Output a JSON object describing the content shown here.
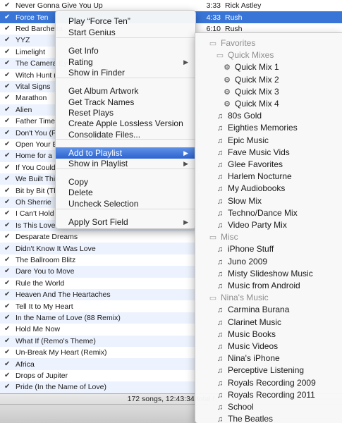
{
  "colors": {
    "selection": "#3875d7",
    "row_stripe": "#edf3fe",
    "menu_highlight": "#2c62d0"
  },
  "icons": {
    "check": "checkmark-icon",
    "submenu": "triangle-right-icon",
    "folder": "folder-icon",
    "smart_playlist": "smart-playlist-icon",
    "playlist": "playlist-icon"
  },
  "tracks": [
    {
      "name": "Never Gonna Give You Up",
      "time": "3:33",
      "artist": "Rick Astley"
    },
    {
      "name": "Force Ten",
      "time": "4:33",
      "artist": "Rush"
    },
    {
      "name": "Red Barchetta",
      "time": "6:10",
      "artist": "Rush"
    },
    {
      "name": "YYZ",
      "time": "",
      "artist": ""
    },
    {
      "name": "Limelight",
      "time": "",
      "artist": ""
    },
    {
      "name": "The Camera Eye",
      "time": "",
      "artist": ""
    },
    {
      "name": "Witch Hunt (",
      "time": "",
      "artist": ""
    },
    {
      "name": "Vital Signs",
      "time": "",
      "artist": ""
    },
    {
      "name": "Marathon",
      "time": "",
      "artist": ""
    },
    {
      "name": "Alien",
      "time": "",
      "artist": ""
    },
    {
      "name": "Father Time",
      "time": "",
      "artist": ""
    },
    {
      "name": "Don't You (F",
      "time": "",
      "artist": ""
    },
    {
      "name": "Open Your E",
      "time": "",
      "artist": ""
    },
    {
      "name": "Home for a",
      "time": "",
      "artist": ""
    },
    {
      "name": "If You Could",
      "time": "",
      "artist": ""
    },
    {
      "name": "We Built This",
      "time": "",
      "artist": ""
    },
    {
      "name": "Bit by Bit (Th",
      "time": "",
      "artist": ""
    },
    {
      "name": "Oh Sherrie",
      "time": "",
      "artist": ""
    },
    {
      "name": "I Can't Hold",
      "time": "",
      "artist": ""
    },
    {
      "name": "Is This Love",
      "time": "",
      "artist": ""
    },
    {
      "name": "Desparate Dreams",
      "time": "",
      "artist": ""
    },
    {
      "name": "Didn't Know It Was Love",
      "time": "",
      "artist": ""
    },
    {
      "name": "The Ballroom Blitz",
      "time": "",
      "artist": ""
    },
    {
      "name": "Dare You to Move",
      "time": "",
      "artist": ""
    },
    {
      "name": "Rule the World",
      "time": "",
      "artist": ""
    },
    {
      "name": "Heaven And The Heartaches",
      "time": "",
      "artist": ""
    },
    {
      "name": "Tell It to My Heart",
      "time": "",
      "artist": ""
    },
    {
      "name": "In the Name of Love (88 Remix)",
      "time": "",
      "artist": ""
    },
    {
      "name": "Hold Me Now",
      "time": "",
      "artist": ""
    },
    {
      "name": "What If (Remo's Theme)",
      "time": "",
      "artist": ""
    },
    {
      "name": "Un-Break My Heart (Remix)",
      "time": "",
      "artist": ""
    },
    {
      "name": "Africa",
      "time": "",
      "artist": ""
    },
    {
      "name": "Drops of Jupiter",
      "time": "",
      "artist": ""
    },
    {
      "name": "Pride (In the Name of Love)",
      "time": "",
      "artist": ""
    }
  ],
  "status": {
    "text": "172 songs, 12:43:34 total t"
  },
  "context_menu": {
    "groups": [
      [
        {
          "label": "Play “Force Ten”"
        },
        {
          "label": "Start Genius"
        }
      ],
      [
        {
          "label": "Get Info"
        },
        {
          "label": "Rating",
          "submenu": true
        },
        {
          "label": "Show in Finder"
        }
      ],
      [
        {
          "label": "Get Album Artwork"
        },
        {
          "label": "Get Track Names"
        },
        {
          "label": "Reset Plays"
        },
        {
          "label": "Create Apple Lossless Version"
        },
        {
          "label": "Consolidate Files..."
        }
      ],
      [
        {
          "label": "Add to Playlist",
          "submenu": true,
          "highlighted": true
        },
        {
          "label": "Show in Playlist",
          "submenu": true
        }
      ],
      [
        {
          "label": "Copy"
        },
        {
          "label": "Delete"
        },
        {
          "label": "Uncheck Selection"
        }
      ],
      [
        {
          "label": "Apply Sort Field",
          "submenu": true
        }
      ]
    ]
  },
  "playlist_menu": {
    "items": [
      {
        "label": "Favorites",
        "kind": "folder",
        "level": 0
      },
      {
        "label": "Quick Mixes",
        "kind": "folder",
        "level": 1
      },
      {
        "label": "Quick Mix 1",
        "kind": "smart",
        "level": 2
      },
      {
        "label": "Quick Mix 2",
        "kind": "smart",
        "level": 2
      },
      {
        "label": "Quick Mix 3",
        "kind": "smart",
        "level": 2
      },
      {
        "label": "Quick Mix 4",
        "kind": "smart",
        "level": 2
      },
      {
        "label": "80s Gold",
        "kind": "playlist",
        "level": 1
      },
      {
        "label": "Eighties Memories",
        "kind": "playlist",
        "level": 1
      },
      {
        "label": "Epic Music",
        "kind": "playlist",
        "level": 1
      },
      {
        "label": "Fave Music Vids",
        "kind": "playlist",
        "level": 1
      },
      {
        "label": "Glee Favorites",
        "kind": "playlist",
        "level": 1
      },
      {
        "label": "Harlem Nocturne",
        "kind": "playlist",
        "level": 1
      },
      {
        "label": "My Audiobooks",
        "kind": "playlist",
        "level": 1
      },
      {
        "label": "Slow Mix",
        "kind": "playlist",
        "level": 1
      },
      {
        "label": "Techno/Dance Mix",
        "kind": "playlist",
        "level": 1
      },
      {
        "label": "Video Party Mix",
        "kind": "playlist",
        "level": 1
      },
      {
        "label": "Misc",
        "kind": "folder",
        "level": 0
      },
      {
        "label": "iPhone Stuff",
        "kind": "playlist",
        "level": 1
      },
      {
        "label": "Juno 2009",
        "kind": "playlist",
        "level": 1
      },
      {
        "label": "Misty Slideshow Music",
        "kind": "playlist",
        "level": 1
      },
      {
        "label": "Music from Android",
        "kind": "playlist",
        "level": 1
      },
      {
        "label": "Nina's Music",
        "kind": "folder",
        "level": 0
      },
      {
        "label": "Carmina Burana",
        "kind": "playlist",
        "level": 1
      },
      {
        "label": "Clarinet Music",
        "kind": "playlist",
        "level": 1
      },
      {
        "label": "Music Books",
        "kind": "playlist",
        "level": 1
      },
      {
        "label": "Music Videos",
        "kind": "playlist",
        "level": 1
      },
      {
        "label": "Nina's iPhone",
        "kind": "playlist",
        "level": 1
      },
      {
        "label": "Perceptive Listening",
        "kind": "playlist",
        "level": 1
      },
      {
        "label": "Royals Recording 2009",
        "kind": "playlist",
        "level": 1
      },
      {
        "label": "Royals Recording 2011",
        "kind": "playlist",
        "level": 1
      },
      {
        "label": "School",
        "kind": "playlist",
        "level": 1
      },
      {
        "label": "The Beatles",
        "kind": "playlist",
        "level": 1
      }
    ]
  }
}
